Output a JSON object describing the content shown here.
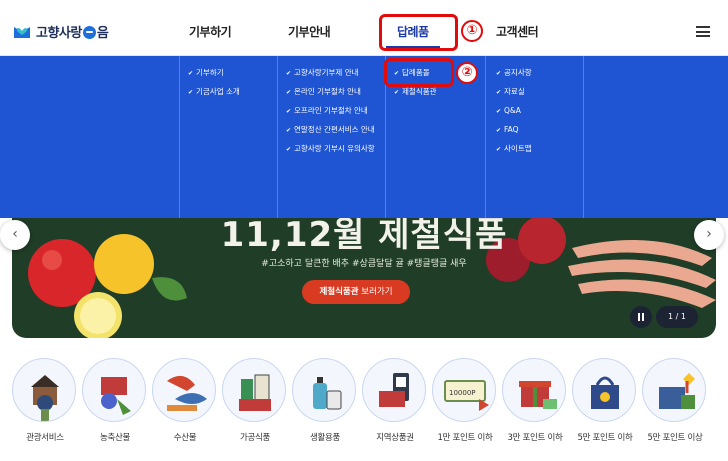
{
  "header": {
    "logo_text_left": "고향사랑",
    "logo_text_right": "음",
    "nav": [
      "기부하기",
      "기부안내",
      "답례품",
      "고객센터"
    ],
    "annotation_1": "①",
    "annotation_2": "②"
  },
  "dropdown": {
    "columns": [
      [
        "기부하기",
        "기금사업 소개"
      ],
      [
        "고향사랑기부제 안내",
        "온라인 기부절차 안내",
        "오프라인 기부절차 안내",
        "연말정산 간편서비스 안내",
        "고향사랑 기부시 유의사항"
      ],
      [
        "답례품몰",
        "제철식품관"
      ],
      [
        "공지사항",
        "자료실",
        "Q&A",
        "FAQ",
        "사이트맵"
      ]
    ]
  },
  "banner": {
    "title": "11,12월 제철식품",
    "tags": "#고소하고 달큰한 배추  #상큼달달 귤  #탱글탱글 새우",
    "button_bold": "제철식품관",
    "button_rest": " 보러가기",
    "pager": "1 / 1",
    "prev": "‹",
    "next": "›"
  },
  "categories": [
    "관광서비스",
    "농축산물",
    "수산물",
    "가공식품",
    "생활용품",
    "지역상품권",
    "1만 포인트 이하",
    "3만 포인트 이하",
    "5만 포인트 이하",
    "5만 포인트 이상"
  ],
  "colors": {
    "brand_blue": "#1b3aa8",
    "dropdown_bg": "#1f55d2",
    "annotation_red": "#e10b0b",
    "banner_bg": "#1f3d27",
    "button_red": "#d93a22"
  }
}
